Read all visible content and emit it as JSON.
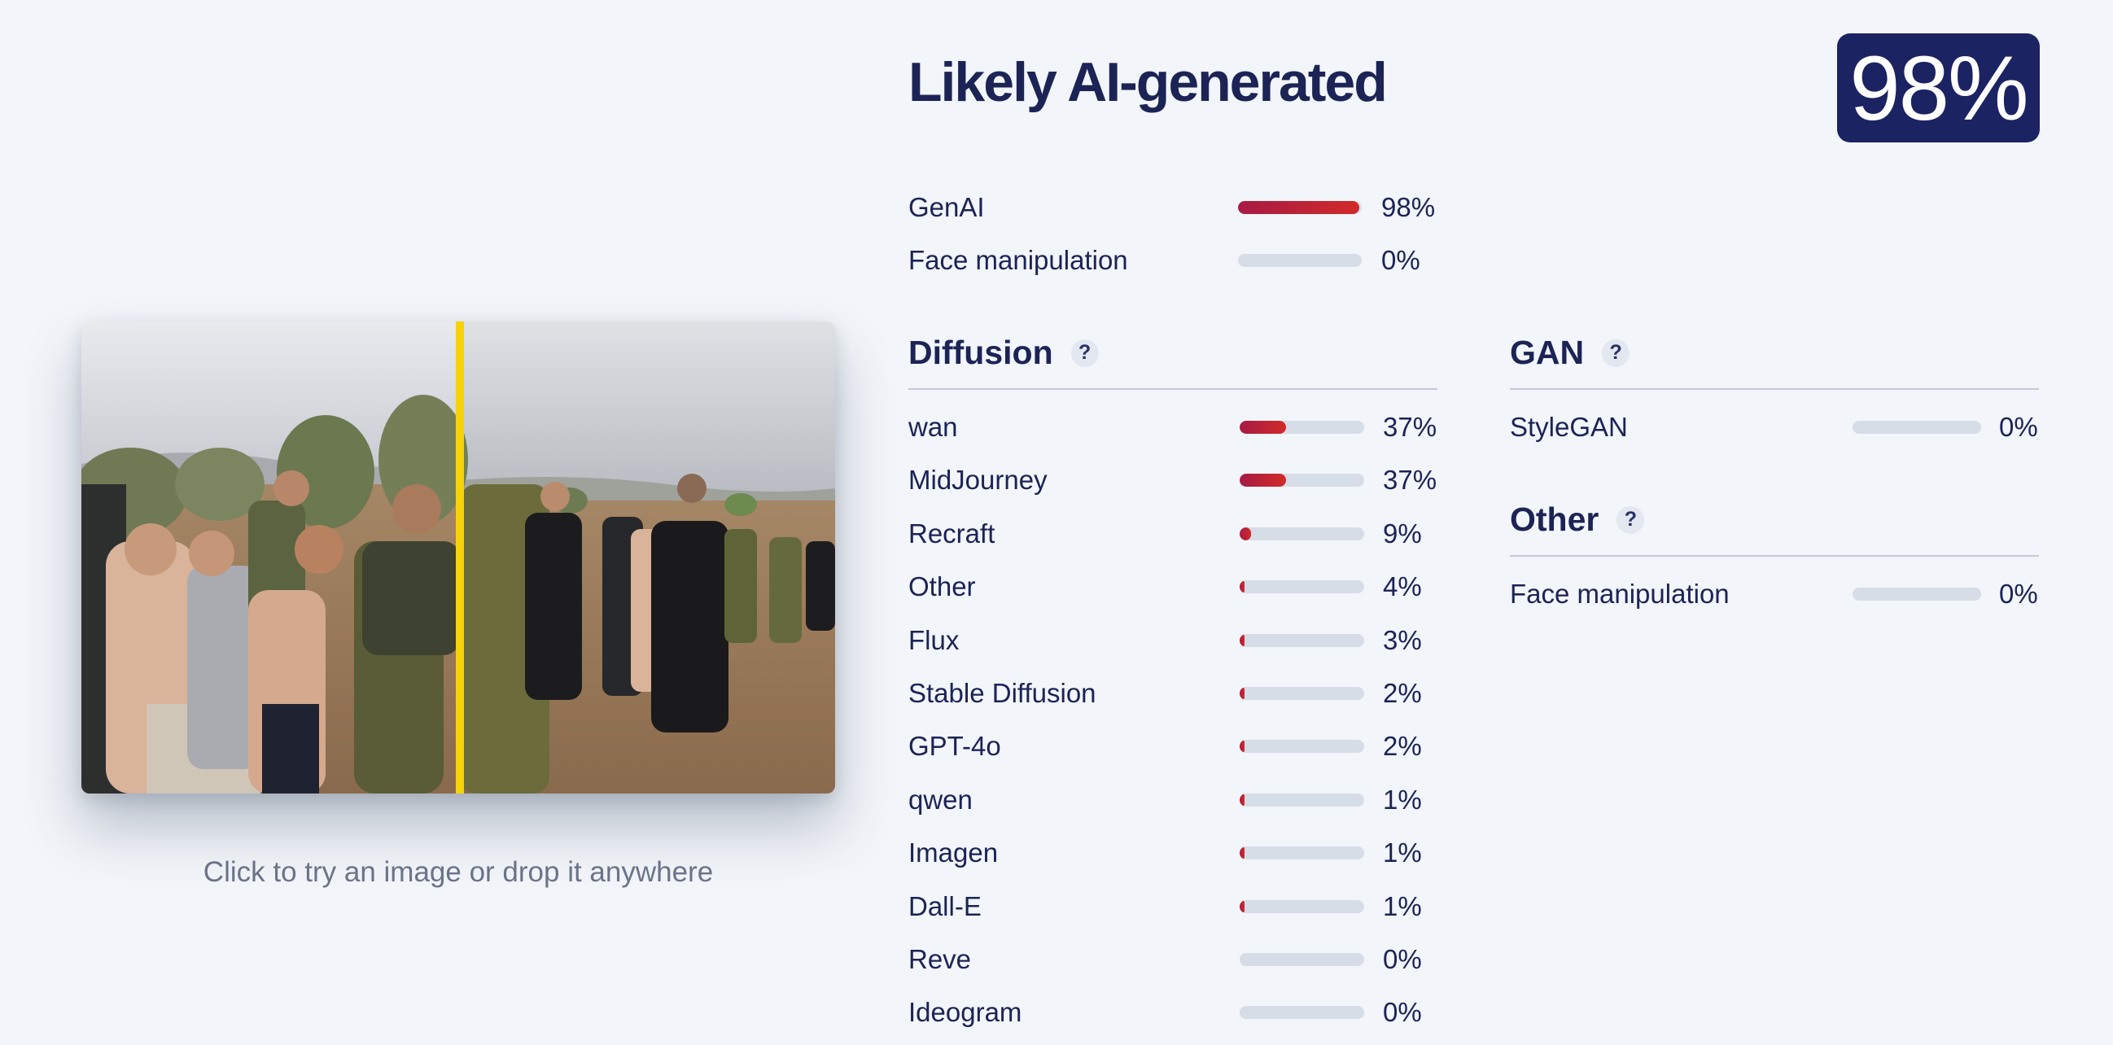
{
  "result": {
    "verdict": "Likely AI-generated",
    "score": "98%"
  },
  "summary": [
    {
      "label": "GenAI",
      "value": 0.98,
      "pct": "98%"
    },
    {
      "label": "Face manipulation",
      "value": 0.0,
      "pct": "0%"
    }
  ],
  "diffusion": {
    "title": "Diffusion",
    "help": "?",
    "items": [
      {
        "label": "wan",
        "value": 0.37,
        "pct": "37%"
      },
      {
        "label": "MidJourney",
        "value": 0.37,
        "pct": "37%"
      },
      {
        "label": "Recraft",
        "value": 0.09,
        "pct": "9%"
      },
      {
        "label": "Other",
        "value": 0.04,
        "pct": "4%"
      },
      {
        "label": "Flux",
        "value": 0.03,
        "pct": "3%"
      },
      {
        "label": "Stable Diffusion",
        "value": 0.02,
        "pct": "2%"
      },
      {
        "label": "GPT-4o",
        "value": 0.02,
        "pct": "2%"
      },
      {
        "label": "qwen",
        "value": 0.01,
        "pct": "1%"
      },
      {
        "label": "Imagen",
        "value": 0.01,
        "pct": "1%"
      },
      {
        "label": "Dall-E",
        "value": 0.01,
        "pct": "1%"
      },
      {
        "label": "Reve",
        "value": 0.0,
        "pct": "0%"
      },
      {
        "label": "Ideogram",
        "value": 0.0,
        "pct": "0%"
      }
    ]
  },
  "gan": {
    "title": "GAN",
    "help": "?",
    "items": [
      {
        "label": "StyleGAN",
        "value": 0.0,
        "pct": "0%"
      }
    ]
  },
  "other": {
    "title": "Other",
    "help": "?",
    "items": [
      {
        "label": "Face manipulation",
        "value": 0.0,
        "pct": "0%"
      }
    ]
  },
  "image_panel": {
    "hint": "Click to try an image or drop it anywhere"
  },
  "colors": {
    "background": "#f2f5f9",
    "badge": "#1c2363",
    "text": "#1c2355",
    "bar_fill_start": "#a71b45",
    "bar_fill_end": "#d12a2a",
    "bar_track": "#d6dde7",
    "comparison_divider": "#f5d20a"
  }
}
